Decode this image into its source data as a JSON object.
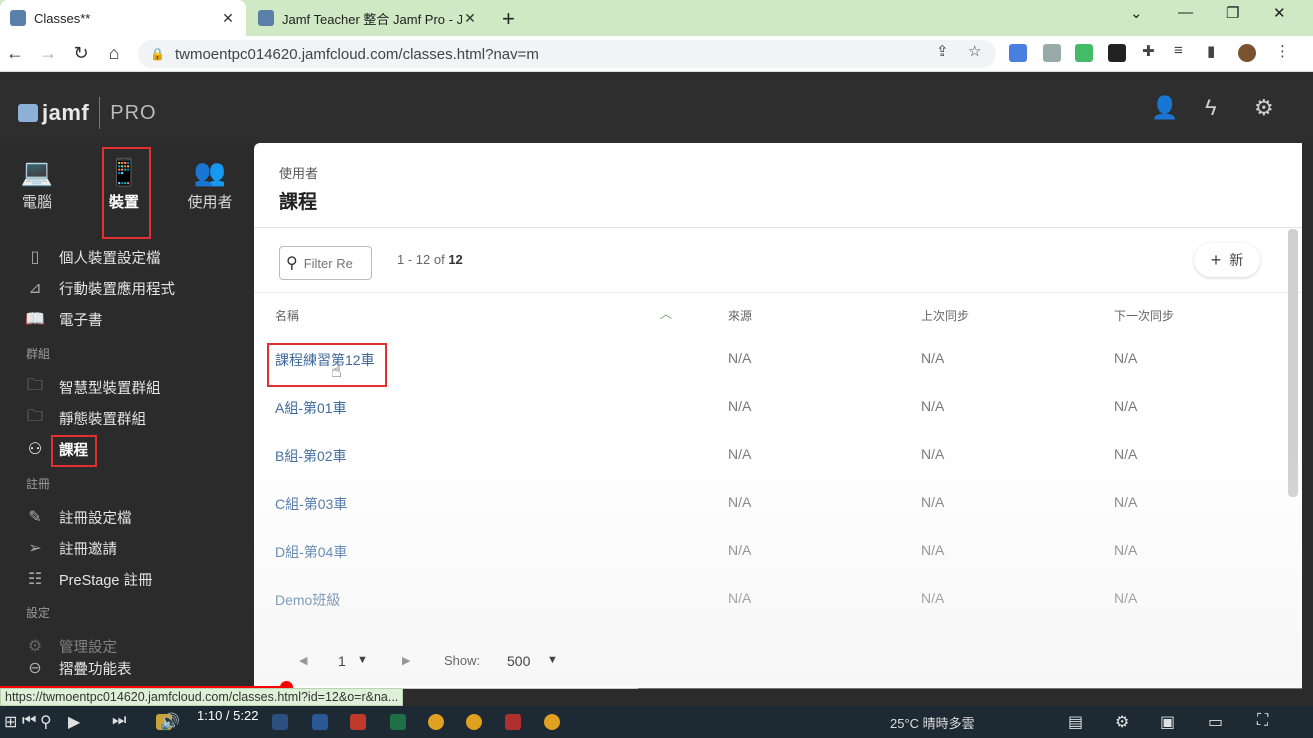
{
  "browser": {
    "tabs": [
      {
        "title": "Classes**",
        "active": true
      },
      {
        "title": "Jamf Teacher 整合 Jamf Pro - Jam",
        "active": false
      }
    ],
    "url": "twmoentpc014620.jamfcloud.com/classes.html?nav=m"
  },
  "app": {
    "logo_text": "jamf",
    "logo_suffix": "PRO"
  },
  "sidebar": {
    "categories": [
      {
        "label": "電腦",
        "icon": "laptop-icon"
      },
      {
        "label": "裝置",
        "icon": "mobile-device-icon"
      },
      {
        "label": "使用者",
        "icon": "users-icon"
      }
    ],
    "items_top": [
      {
        "label": "個人裝置設定檔",
        "icon": "profile-icon"
      },
      {
        "label": "行動裝置應用程式",
        "icon": "app-store-icon"
      },
      {
        "label": "電子書",
        "icon": "book-icon"
      }
    ],
    "section_groups": "群組",
    "items_groups": [
      {
        "label": "智慧型裝置群組",
        "icon": "smart-group-icon"
      },
      {
        "label": "靜態裝置群組",
        "icon": "static-group-icon"
      },
      {
        "label": "課程",
        "icon": "classes-icon"
      }
    ],
    "section_enroll": "註冊",
    "items_enroll": [
      {
        "label": "註冊設定檔",
        "icon": "enrollment-profile-icon"
      },
      {
        "label": "註冊邀請",
        "icon": "invitation-icon"
      },
      {
        "label": "PreStage 註冊",
        "icon": "prestage-icon"
      }
    ],
    "section_settings": "設定",
    "settings_item": "管理設定",
    "collapse": "摺疊功能表"
  },
  "main": {
    "breadcrumb": "使用者",
    "title": "課程",
    "filter_placeholder": "Filter Re",
    "count_prefix": "1 - 12 of ",
    "count_total": "12",
    "new_label": "新",
    "columns": [
      "名稱",
      "來源",
      "上次同步",
      "下一次同步"
    ],
    "rows": [
      {
        "name": "課程練習第12車",
        "source": "N/A",
        "last_sync": "N/A",
        "next_sync": "N/A"
      },
      {
        "name": "A組-第01車",
        "source": "N/A",
        "last_sync": "N/A",
        "next_sync": "N/A"
      },
      {
        "name": "B組-第02車",
        "source": "N/A",
        "last_sync": "N/A",
        "next_sync": "N/A"
      },
      {
        "name": "C組-第03車",
        "source": "N/A",
        "last_sync": "N/A",
        "next_sync": "N/A"
      },
      {
        "name": "D組-第04車",
        "source": "N/A",
        "last_sync": "N/A",
        "next_sync": "N/A"
      },
      {
        "name": "Demo班級",
        "source": "N/A",
        "last_sync": "N/A",
        "next_sync": "N/A"
      }
    ],
    "pager": {
      "page": "1",
      "show_label": "Show:",
      "show_value": "500"
    }
  },
  "overlay": {
    "status_url": "https://twmoentpc014620.jamfcloud.com/classes.html?id=12&o=r&na...",
    "timecode": "1:10 / 5:22",
    "progress_fraction": 0.22,
    "buffered_fraction": 0.49,
    "weather": "25°C  晴時多雲"
  }
}
